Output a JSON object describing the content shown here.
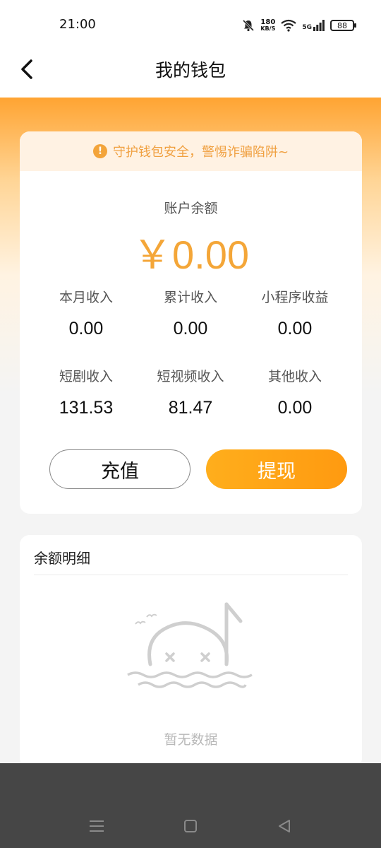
{
  "status_bar": {
    "time": "21:00",
    "net_speed_value": "180",
    "net_speed_unit": "KB/S",
    "network_type": "5G",
    "battery": "88"
  },
  "header": {
    "title": "我的钱包",
    "back_icon": "chevron-left-icon"
  },
  "wallet": {
    "warning": "守护钱包安全，警惕诈骗陷阱~",
    "balance_label": "账户余额",
    "balance_value": "￥0.00",
    "accent_color": "#f4a638",
    "stats": [
      {
        "label": "本月收入",
        "value": "0.00"
      },
      {
        "label": "累计收入",
        "value": "0.00"
      },
      {
        "label": "小程序收益",
        "value": "0.00"
      },
      {
        "label": "短剧收入",
        "value": "131.53"
      },
      {
        "label": "短视频收入",
        "value": "81.47"
      },
      {
        "label": "其他收入",
        "value": "0.00"
      }
    ],
    "recharge_label": "充值",
    "withdraw_label": "提现"
  },
  "details": {
    "title": "余额明细",
    "empty_text": "暂无数据"
  },
  "nav": {
    "icons": [
      "menu-icon",
      "home-square-icon",
      "back-triangle-icon"
    ]
  }
}
